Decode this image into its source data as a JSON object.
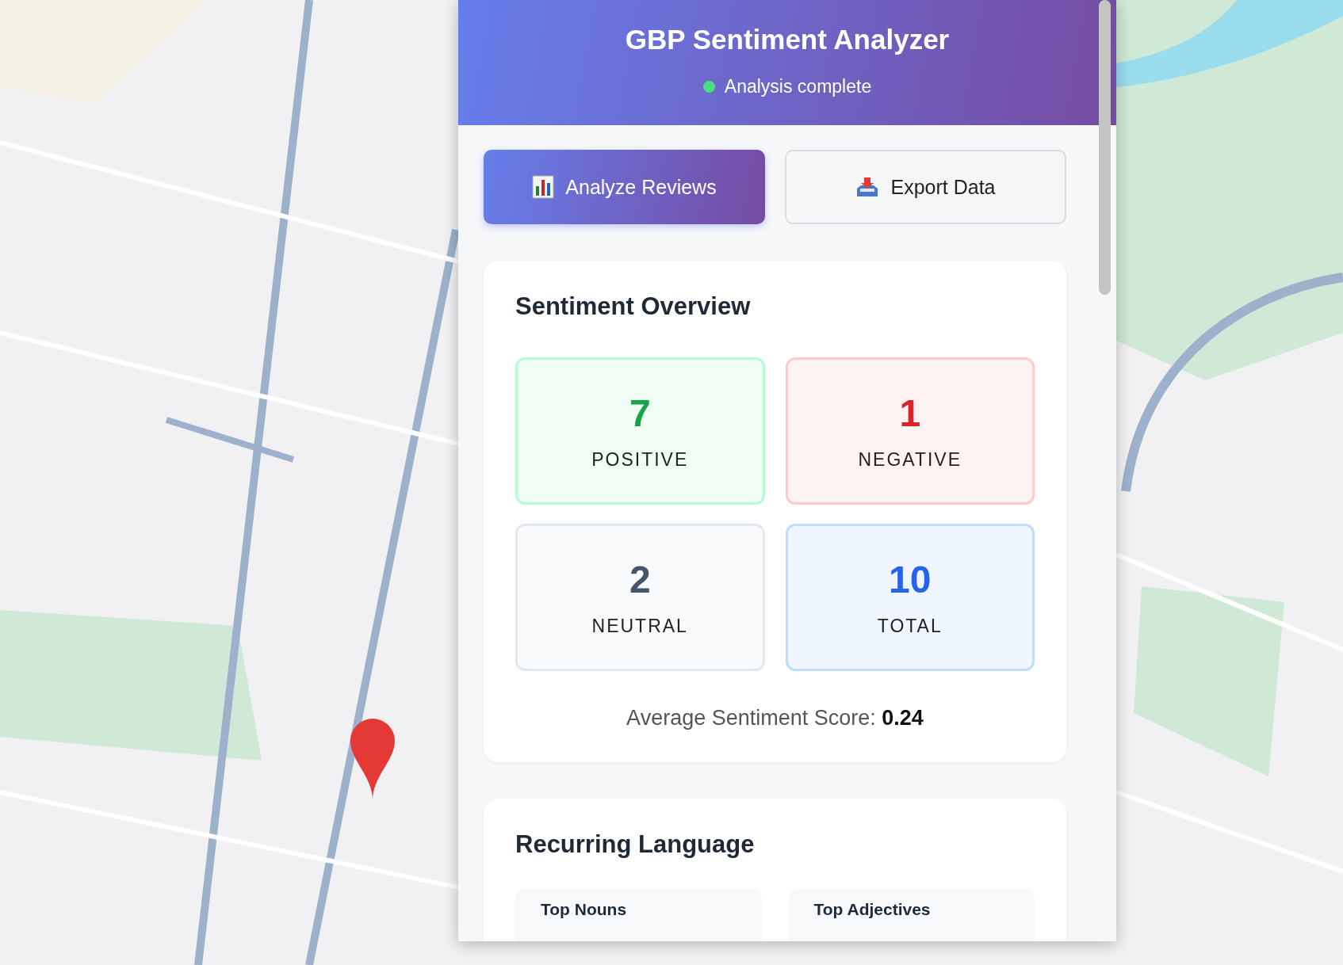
{
  "header": {
    "title": "GBP Sentiment Analyzer",
    "status": {
      "text": "Analysis complete",
      "kind": "complete"
    }
  },
  "actions": [
    {
      "label": "Analyze Reviews",
      "kind": "chart",
      "primary": true
    },
    {
      "label": "Export Data",
      "kind": "tray",
      "primary": false
    }
  ],
  "overview": {
    "title": "Sentiment Overview",
    "stats": [
      {
        "kind": "positive",
        "value": "7",
        "label": "POSITIVE"
      },
      {
        "kind": "negative",
        "value": "1",
        "label": "NEGATIVE"
      },
      {
        "kind": "neutral",
        "value": "2",
        "label": "NEUTRAL"
      },
      {
        "kind": "total",
        "value": "10",
        "label": "TOTAL"
      }
    ],
    "average": {
      "label": "Average Sentiment Score:",
      "value": "0.24"
    }
  },
  "language": {
    "title": "Recurring Language",
    "columns": [
      {
        "title": "Top Nouns"
      },
      {
        "title": "Top Adjectives"
      }
    ]
  }
}
